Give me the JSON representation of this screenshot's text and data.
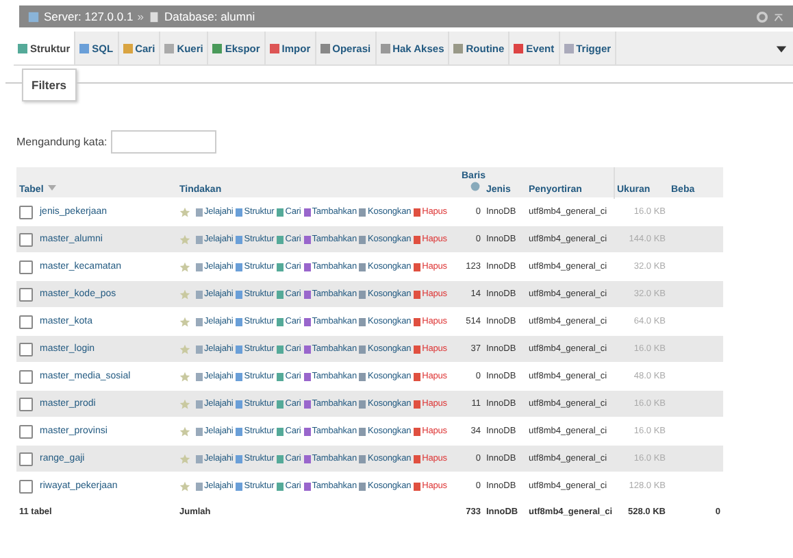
{
  "breadcrumb": {
    "server": "Server: 127.0.0.1",
    "separator": "»",
    "database": "Database: alumni"
  },
  "tabs": [
    {
      "label": "Struktur",
      "selected": true
    },
    {
      "label": "SQL",
      "selected": false
    },
    {
      "label": "Cari",
      "selected": false
    },
    {
      "label": "Kueri",
      "selected": false
    },
    {
      "label": "Ekspor",
      "selected": false
    },
    {
      "label": "Impor",
      "selected": false
    },
    {
      "label": "Operasi",
      "selected": false
    },
    {
      "label": "Hak Akses",
      "selected": false
    },
    {
      "label": "Routine",
      "selected": false
    },
    {
      "label": "Event",
      "selected": false
    },
    {
      "label": "Trigger",
      "selected": false
    }
  ],
  "filters": {
    "legend": "Filters",
    "label": "Mengandung kata:"
  },
  "table": {
    "columns": [
      "Tabel",
      "Tindakan",
      "Baris",
      "Jenis",
      "Penyortiran",
      "Ukuran",
      "Beba"
    ],
    "rows": [
      {
        "name": "jenis_pekerjaan",
        "checked": false,
        "actions": [
          "Jelajahi",
          "Struktur",
          "Cari",
          "Tambahkan",
          "Kosongkan",
          "Hapus"
        ],
        "rows": "0",
        "engine": "InnoDB",
        "collation": "utf8mb4_general_ci",
        "size": "16.0 KB"
      },
      {
        "name": "master_alumni",
        "checked": false,
        "actions": [
          "Jelajahi",
          "Struktur",
          "Cari",
          "Tambahkan",
          "Kosongkan",
          "Hapus"
        ],
        "rows": "0",
        "engine": "InnoDB",
        "collation": "utf8mb4_general_ci",
        "size": "144.0 KB"
      },
      {
        "name": "master_kecamatan",
        "checked": false,
        "actions": [
          "Jelajahi",
          "Struktur",
          "Cari",
          "Tambahkan",
          "Kosongkan",
          "Hapus"
        ],
        "rows": "123",
        "engine": "InnoDB",
        "collation": "utf8mb4_general_ci",
        "size": "32.0 KB"
      },
      {
        "name": "master_kode_pos",
        "checked": false,
        "actions": [
          "Jelajahi",
          "Struktur",
          "Cari",
          "Tambahkan",
          "Kosongkan",
          "Hapus"
        ],
        "rows": "14",
        "engine": "InnoDB",
        "collation": "utf8mb4_general_ci",
        "size": "32.0 KB"
      },
      {
        "name": "master_kota",
        "checked": false,
        "actions": [
          "Jelajahi",
          "Struktur",
          "Cari",
          "Tambahkan",
          "Kosongkan",
          "Hapus"
        ],
        "rows": "514",
        "engine": "InnoDB",
        "collation": "utf8mb4_general_ci",
        "size": "64.0 KB"
      },
      {
        "name": "master_login",
        "checked": false,
        "actions": [
          "Jelajahi",
          "Struktur",
          "Cari",
          "Tambahkan",
          "Kosongkan",
          "Hapus"
        ],
        "rows": "37",
        "engine": "InnoDB",
        "collation": "utf8mb4_general_ci",
        "size": "16.0 KB"
      },
      {
        "name": "master_media_sosial",
        "checked": false,
        "actions": [
          "Jelajahi",
          "Struktur",
          "Cari",
          "Tambahkan",
          "Kosongkan",
          "Hapus"
        ],
        "rows": "0",
        "engine": "InnoDB",
        "collation": "utf8mb4_general_ci",
        "size": "48.0 KB"
      },
      {
        "name": "master_prodi",
        "checked": false,
        "actions": [
          "Jelajahi",
          "Struktur",
          "Cari",
          "Tambahkan",
          "Kosongkan",
          "Hapus"
        ],
        "rows": "11",
        "engine": "InnoDB",
        "collation": "utf8mb4_general_ci",
        "size": "16.0 KB"
      },
      {
        "name": "master_provinsi",
        "checked": false,
        "actions": [
          "Jelajahi",
          "Struktur",
          "Cari",
          "Tambahkan",
          "Kosongkan",
          "Hapus"
        ],
        "rows": "34",
        "engine": "InnoDB",
        "collation": "utf8mb4_general_ci",
        "size": "16.0 KB"
      },
      {
        "name": "range_gaji",
        "checked": false,
        "actions": [
          "Jelajahi",
          "Struktur",
          "Cari",
          "Tambahkan",
          "Kosongkan",
          "Hapus"
        ],
        "rows": "0",
        "engine": "InnoDB",
        "collation": "utf8mb4_general_ci",
        "size": "16.0 KB"
      },
      {
        "name": "riwayat_pekerjaan",
        "checked": false,
        "actions": [
          "Jelajahi",
          "Struktur",
          "Cari",
          "Tambahkan",
          "Kosongkan",
          "Hapus"
        ],
        "rows": "0",
        "engine": "InnoDB",
        "collation": "utf8mb4_general_ci",
        "size": "128.0 KB"
      }
    ],
    "footer": {
      "count": "11 tabel",
      "label": "Jumlah",
      "rows": "733",
      "engine": "InnoDB",
      "collation": "utf8mb4_general_ci",
      "size": "528.0 KB",
      "overhead": "0"
    }
  }
}
